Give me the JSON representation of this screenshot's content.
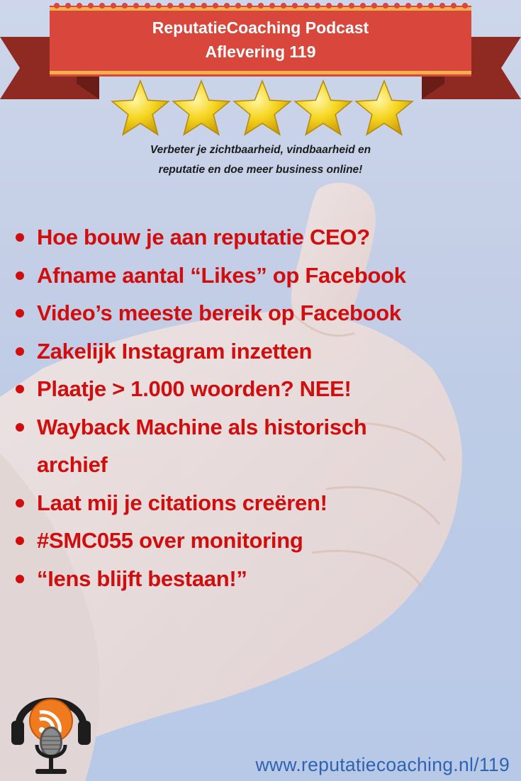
{
  "banner": {
    "title_line1": "ReputatieCoaching Podcast",
    "title_line2": "Aflevering 119",
    "ribbon_color": "#d9463b",
    "ribbon_dark": "#8f2a22",
    "trim_color": "#f2b14a"
  },
  "rating": {
    "stars": 5,
    "star_color": "#f6d51f"
  },
  "tagline": {
    "line1": "Verbeter je zichtbaarheid, vindbaarheid en",
    "line2": "reputatie en doe meer business online!"
  },
  "topics": [
    [
      "Hoe bouw je aan reputatie CEO?"
    ],
    [
      "Afname aantal “Likes” op Facebook"
    ],
    [
      "Video’s meeste bereik op Facebook"
    ],
    [
      "Zakelijk Instagram inzetten"
    ],
    [
      "Plaatje > 1.000 woorden? NEE!"
    ],
    [
      "Wayback Machine als historisch",
      "archief"
    ],
    [
      "Laat mij je citations creëren!"
    ],
    [
      "#SMC055 over monitoring"
    ],
    [
      "“Iens blijft bestaan!”"
    ]
  ],
  "footer": {
    "url": "www.reputatiecoaching.nl/119",
    "url_color": "#2f63b2"
  },
  "icons": {
    "podcast": "podcast-microphone-icon",
    "background": "thumbs-up-hand"
  },
  "colors": {
    "topic_text": "#d10d0d",
    "tagline_text": "#1b1b1b"
  }
}
